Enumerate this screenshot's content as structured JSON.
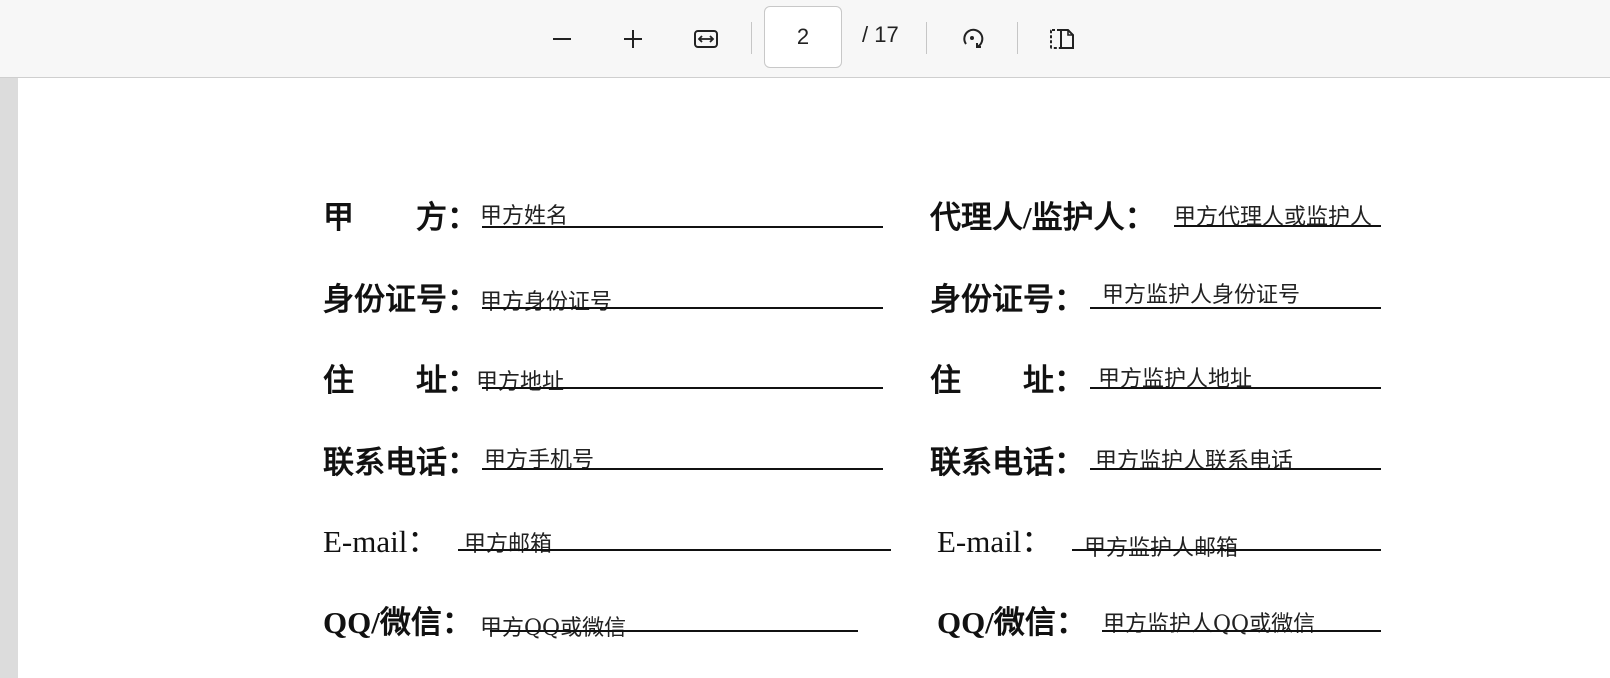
{
  "toolbar": {
    "buttons": {
      "zoom_out": "minus-icon",
      "zoom_in": "plus-icon",
      "fit_width": "fit-width-icon",
      "rotate": "rotate-icon",
      "two_page": "page-view-icon"
    },
    "page_current": "2",
    "page_total": "/ 17"
  },
  "form": {
    "left": [
      {
        "label": "甲　　方",
        "colon": "：",
        "value": "甲方姓名"
      },
      {
        "label": "身份证号",
        "colon": "：",
        "value": "甲方身份证号"
      },
      {
        "label": "住　　址",
        "colon": "：",
        "value": "甲方地址"
      },
      {
        "label": "联系电话",
        "colon": "：",
        "value": "甲方手机号"
      },
      {
        "label": "E-mail",
        "colon": "：",
        "value": "甲方邮箱"
      },
      {
        "label": "QQ/微信",
        "colon": "：",
        "value": "甲方QQ或微信"
      }
    ],
    "right": [
      {
        "label": "代理人/监护人",
        "colon": "：",
        "value": "甲方代理人或监护人"
      },
      {
        "label": "身份证号",
        "colon": "：",
        "value": "甲方监护人身份证号"
      },
      {
        "label": "住　　址",
        "colon": "：",
        "value": "甲方监护人地址"
      },
      {
        "label": "联系电话",
        "colon": "：",
        "value": "甲方监护人联系电话"
      },
      {
        "label": "E-mail",
        "colon": "：",
        "value": "甲方监护人邮箱"
      },
      {
        "label": "QQ/微信",
        "colon": "：",
        "value": "甲方监护人QQ或微信"
      }
    ]
  }
}
